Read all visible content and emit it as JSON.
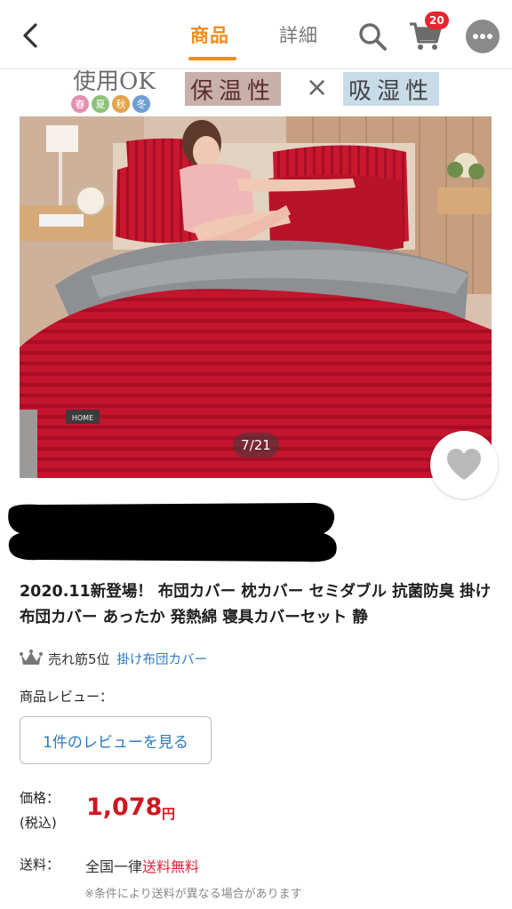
{
  "header": {
    "tab_product": "商品",
    "tab_detail": "詳細",
    "cart_count": "20",
    "accent": "#f28c1a"
  },
  "banner": {
    "ok_text": "使用OK",
    "seasons": [
      "春",
      "夏",
      "秋",
      "冬"
    ],
    "season_colors": [
      "#e58fb0",
      "#8fc07a",
      "#e5a24a",
      "#6f9ed2"
    ],
    "box1": "保温性",
    "times": "×",
    "box2": "吸湿性"
  },
  "image": {
    "counter": "7/21"
  },
  "product": {
    "title": "2020.11新登場！ 布団カバー 枕カバー セミダブル 抗菌防臭 掛け布団カバー あったか 発熱綿 寝具カバーセット 静",
    "rank_text": "売れ筋5位",
    "rank_link": "掛け布団カバー",
    "review_label": "商品レビュー：",
    "review_button": "1件のレビューを見る",
    "price_label": "価格：",
    "price_tax": "(税込)",
    "price": "1,078",
    "price_unit": "円",
    "shipping_label": "送料：",
    "shipping_prefix": "全国一律",
    "shipping_free": "送料無料",
    "shipping_note": "※条件により送料が異なる場合があります"
  }
}
